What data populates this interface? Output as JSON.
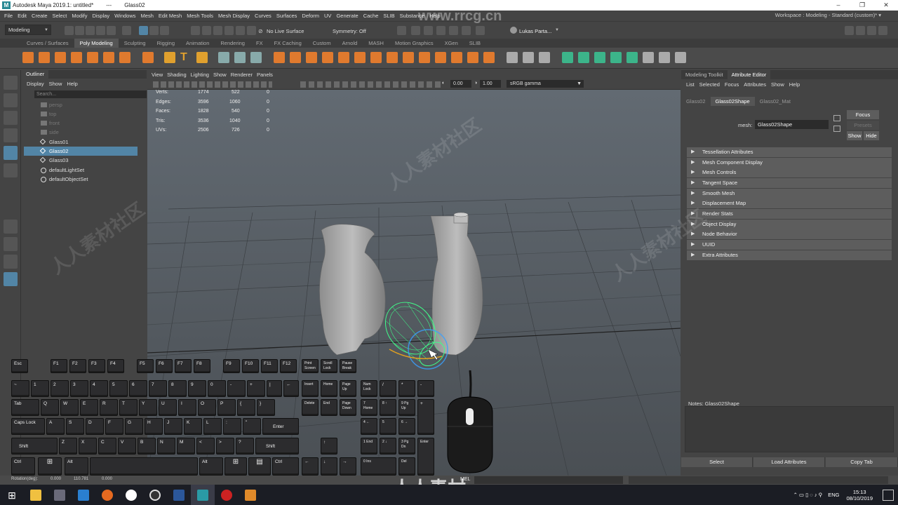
{
  "window": {
    "app_logo": "M",
    "title": "Autodesk Maya 2019.1: untitled*",
    "separator": "---",
    "selection": "Glass02",
    "controls": [
      "–",
      "❐",
      "✕"
    ]
  },
  "menus": [
    "File",
    "Edit",
    "Create",
    "Select",
    "Modify",
    "Display",
    "Windows",
    "Mesh",
    "Edit Mesh",
    "Mesh Tools",
    "Mesh Display",
    "Curves",
    "Surfaces",
    "Deform",
    "UV",
    "Generate",
    "Cache",
    "SLIB",
    "Substance",
    "Help"
  ],
  "workspace": {
    "label": "Workspace :",
    "value": "Modeling - Standard (custom)*"
  },
  "statusline": {
    "mode": "Modeling",
    "live_surface": "No Live Surface",
    "symmetry": "Symmetry: Off",
    "user": "Lukas Parta..."
  },
  "shelf_tabs": [
    "Curves / Surfaces",
    "Poly Modeling",
    "Sculpting",
    "Rigging",
    "Animation",
    "Rendering",
    "FX",
    "FX Caching",
    "Custom",
    "Arnold",
    "MASH",
    "Motion Graphics",
    "XGen",
    "SLIB"
  ],
  "shelf_active": "Poly Modeling",
  "outliner": {
    "tab": "Outliner",
    "menu": [
      "Display",
      "Show",
      "Help"
    ],
    "search_placeholder": "Search...",
    "items": [
      {
        "label": "persp",
        "dim": true
      },
      {
        "label": "top",
        "dim": true
      },
      {
        "label": "front",
        "dim": true
      },
      {
        "label": "side",
        "dim": true
      },
      {
        "label": "Glass01",
        "dim": false
      },
      {
        "label": "Glass02",
        "dim": false,
        "selected": true
      },
      {
        "label": "Glass03",
        "dim": false
      },
      {
        "label": "defaultLightSet",
        "dim": false
      },
      {
        "label": "defaultObjectSet",
        "dim": false
      }
    ]
  },
  "viewport": {
    "menu": [
      "View",
      "Shading",
      "Lighting",
      "Show",
      "Renderer",
      "Panels"
    ],
    "exposure": "0.00",
    "gamma": "1.00",
    "color_space": "sRGB gamma",
    "hud": [
      {
        "label": "Verts:",
        "a": "1774",
        "b": "522",
        "c": "0"
      },
      {
        "label": "Edges:",
        "a": "3596",
        "b": "1060",
        "c": "0"
      },
      {
        "label": "Faces:",
        "a": "1828",
        "b": "540",
        "c": "0"
      },
      {
        "label": "Tris:",
        "a": "3536",
        "b": "1040",
        "c": "0"
      },
      {
        "label": "UVs:",
        "a": "2506",
        "b": "726",
        "c": "0"
      }
    ],
    "watermark_url": "www.rrcg.cn",
    "watermark_text": "人人素材社区"
  },
  "attribute_editor": {
    "tabs": [
      "Modeling Toolkit",
      "Attribute Editor"
    ],
    "active_tab": "Attribute Editor",
    "menu": [
      "List",
      "Selected",
      "Focus",
      "Attributes",
      "Show",
      "Help"
    ],
    "node_tabs": [
      "Glass02",
      "Glass02Shape",
      "Glass02_Mat"
    ],
    "active_node": "Glass02Shape",
    "mesh_label": "mesh:",
    "mesh_value": "Glass02Shape",
    "focus": "Focus",
    "presets": "Presets",
    "show": "Show",
    "hide": "Hide",
    "sections": [
      "Tessellation Attributes",
      "Mesh Component Display",
      "Mesh Controls",
      "Tangent Space",
      "Smooth Mesh",
      "Displacement Map",
      "Render Stats",
      "Object Display",
      "Node Behavior",
      "UUID",
      "Extra Attributes"
    ],
    "notes": "Notes: Glass02Shape",
    "buttons": [
      "Select",
      "Load Attributes",
      "Copy Tab"
    ]
  },
  "helpline": {
    "rotation_label": "Rotation(deg):",
    "rot_x": "0.000",
    "rot_y": "110.781",
    "rot_z": "0.000",
    "mel": "MEL"
  },
  "taskbar": {
    "language": "ENG",
    "time": "15:13",
    "date": "08/10/2019",
    "brand_watermark": "人人素材"
  },
  "keyboard": {
    "fkeys": [
      "Esc",
      "F1",
      "F2",
      "F3",
      "F4",
      "F5",
      "F6",
      "F7",
      "F8",
      "F9",
      "F10",
      "F11",
      "F12",
      "Print Screen",
      "Scroll Lock",
      "Pause Break"
    ],
    "row1": [
      "~",
      "1",
      "2",
      "3",
      "4",
      "5",
      "6",
      "7",
      "8",
      "9",
      "0",
      "-",
      "+",
      "|",
      "←"
    ],
    "row2": [
      "Tab",
      "Q",
      "W",
      "E",
      "R",
      "T",
      "Y",
      "U",
      "I",
      "O",
      "P",
      "{",
      "}"
    ],
    "row3": [
      "Caps Lock",
      "A",
      "S",
      "D",
      "F",
      "G",
      "H",
      "J",
      "K",
      "L",
      ":",
      "\"",
      "Enter"
    ],
    "row4": [
      "Shift",
      "Z",
      "X",
      "C",
      "V",
      "B",
      "N",
      "M",
      "<",
      ">",
      "?",
      "Shift"
    ],
    "row5": [
      "Ctrl",
      "⊞",
      "Alt",
      "Alt",
      "⊞",
      "▤",
      "Ctrl"
    ],
    "nav": [
      "Insert",
      "Home",
      "Page Up",
      "Delete",
      "End",
      "Page Down"
    ],
    "arrows": [
      "↑",
      "←",
      "↓",
      "→"
    ],
    "numpad": [
      "Num Lock",
      "/",
      "*",
      "-",
      "7 Home",
      "8 ↑",
      "9 Pg Up",
      "+",
      "4 ←",
      "5",
      "6 →",
      "1 End",
      "2 ↓",
      "3 Pg Dn",
      "Enter",
      "0 Ins",
      "Del"
    ]
  }
}
